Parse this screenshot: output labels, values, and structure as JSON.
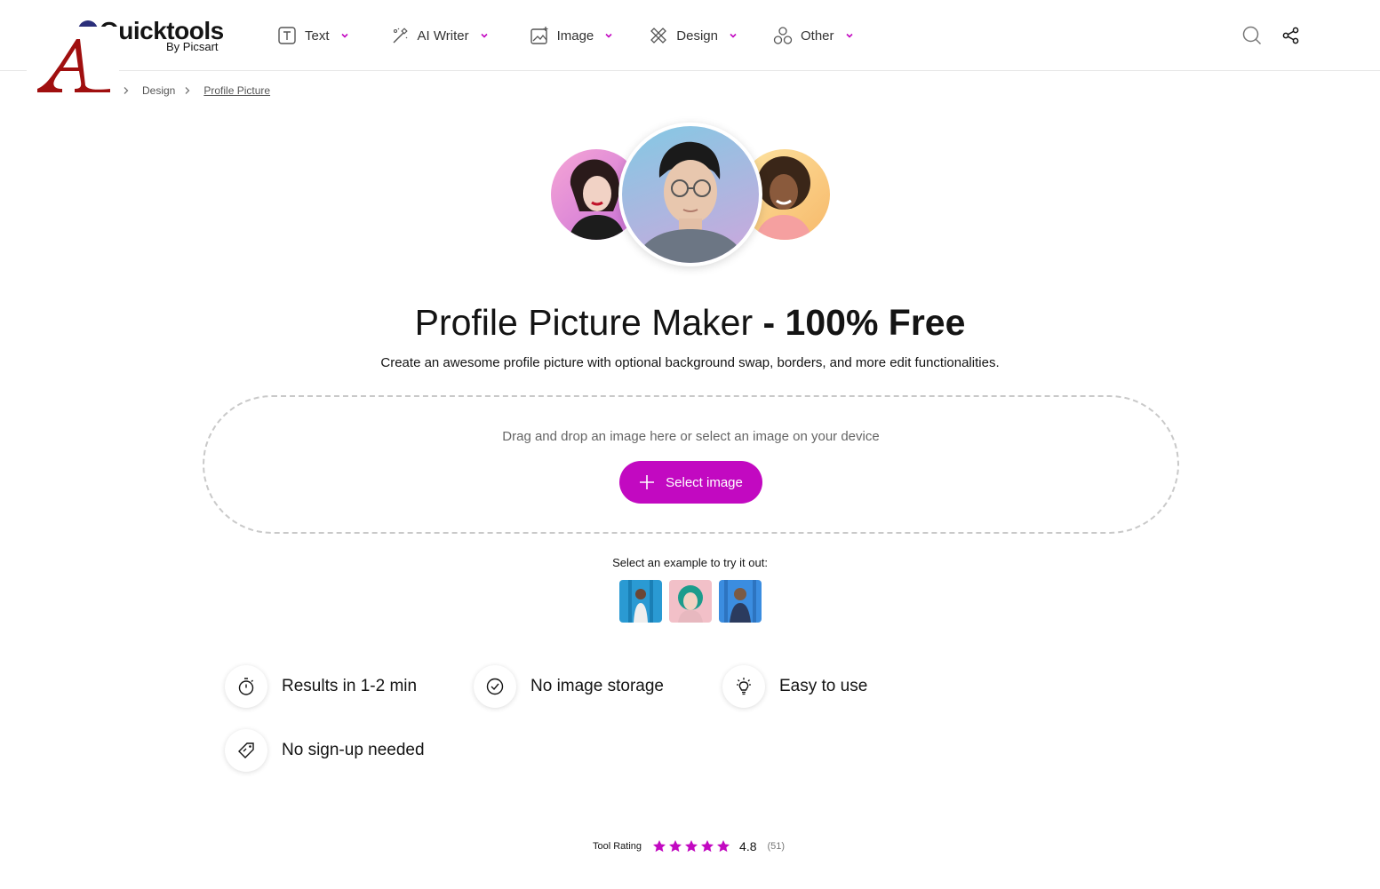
{
  "header": {
    "logo_name": "Quicktools",
    "logo_sub": "By Picsart",
    "nav": [
      {
        "label": "Text",
        "icon": "text-box-icon"
      },
      {
        "label": "AI Writer",
        "icon": "magic-wand-icon"
      },
      {
        "label": "Image",
        "icon": "image-sparkle-icon"
      },
      {
        "label": "Design",
        "icon": "design-tools-icon"
      },
      {
        "label": "Other",
        "icon": "shapes-icon"
      }
    ],
    "search_icon": "search-icon",
    "share_icon": "share-icon"
  },
  "breadcrumb": {
    "items": [
      "Design",
      "Profile Picture"
    ]
  },
  "hero": {
    "title_regular": "Profile Picture Maker ",
    "title_bold": "- 100% Free",
    "subtitle": "Create an awesome profile picture with optional background swap, borders, and more edit functionalities."
  },
  "dropzone": {
    "text": "Drag and drop an image here or select an image on your device",
    "button_label": "Select image"
  },
  "examples": {
    "label": "Select an example to try it out:"
  },
  "features": [
    {
      "label": "Results in 1-2 min",
      "icon": "stopwatch-icon"
    },
    {
      "label": "No image storage",
      "icon": "check-circle-icon"
    },
    {
      "label": "Easy to use",
      "icon": "lightbulb-icon"
    },
    {
      "label": "No sign-up needed",
      "icon": "tag-icon"
    }
  ],
  "rating": {
    "label": "Tool Rating",
    "stars": 5,
    "value": "4.8",
    "count": "(51)"
  },
  "colors": {
    "accent": "#c209c1",
    "text": "#141414",
    "border": "#c9c9c9"
  }
}
